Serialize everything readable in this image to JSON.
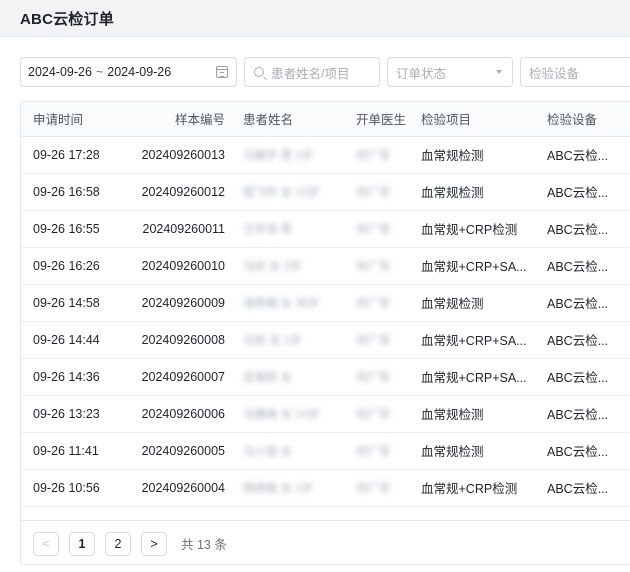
{
  "app_title": "ABC云检订单",
  "filters": {
    "date_start": "2024-09-26",
    "date_sep": "~",
    "date_end": "2024-09-26",
    "search_placeholder": "患者姓名/项目",
    "status_placeholder": "订单状态",
    "device_placeholder": "检验设备"
  },
  "table": {
    "headers": [
      "申请时间",
      "样本编号",
      "患者姓名",
      "开单医生",
      "检验项目",
      "检验设备"
    ],
    "rows": [
      {
        "time": "09-26 17:28",
        "sample": "202409260013",
        "patient": "马娟宇 男 1岁",
        "doctor": "何广军",
        "item": "血常规检测",
        "device": "ABC云检..."
      },
      {
        "time": "09-26 16:58",
        "sample": "202409260012",
        "patient": "程飞玲 女 23岁",
        "doctor": "何广军",
        "item": "血常规检测",
        "device": "ABC云检..."
      },
      {
        "time": "09-26 16:55",
        "sample": "202409260011",
        "patient": "汪宇浩 男",
        "doctor": "何广军",
        "item": "血常规+CRP检测",
        "device": "ABC云检..."
      },
      {
        "time": "09-26 16:26",
        "sample": "202409260010",
        "patient": "马欣 女 2岁",
        "doctor": "何广军",
        "item": "血常规+CRP+SA...",
        "device": "ABC云检..."
      },
      {
        "time": "09-26 14:58",
        "sample": "202409260009",
        "patient": "海秀梅 女 38岁",
        "doctor": "何广军",
        "item": "血常规检测",
        "device": "ABC云检..."
      },
      {
        "time": "09-26 14:44",
        "sample": "202409260008",
        "patient": "马妍 女 1岁",
        "doctor": "何广军",
        "item": "血常规+CRP+SA...",
        "device": "ABC云检..."
      },
      {
        "time": "09-26 14:36",
        "sample": "202409260007",
        "patient": "吴锦妍 女",
        "doctor": "何广军",
        "item": "血常规+CRP+SA...",
        "device": "ABC云检..."
      },
      {
        "time": "09-26 13:23",
        "sample": "202409260006",
        "patient": "马雅梅 女 14岁",
        "doctor": "何广军",
        "item": "血常规检测",
        "device": "ABC云检..."
      },
      {
        "time": "09-26 11:41",
        "sample": "202409260005",
        "patient": "马少挂 女",
        "doctor": "何广军",
        "item": "血常规检测",
        "device": "ABC云检..."
      },
      {
        "time": "09-26 10:56",
        "sample": "202409260004",
        "patient": "杨婷姝 女 1岁",
        "doctor": "何广军",
        "item": "血常规+CRP检测",
        "device": "ABC云检..."
      }
    ]
  },
  "pagination": {
    "prev": "<",
    "pages": [
      "1",
      "2"
    ],
    "next": ">",
    "total": "共 13 条"
  }
}
